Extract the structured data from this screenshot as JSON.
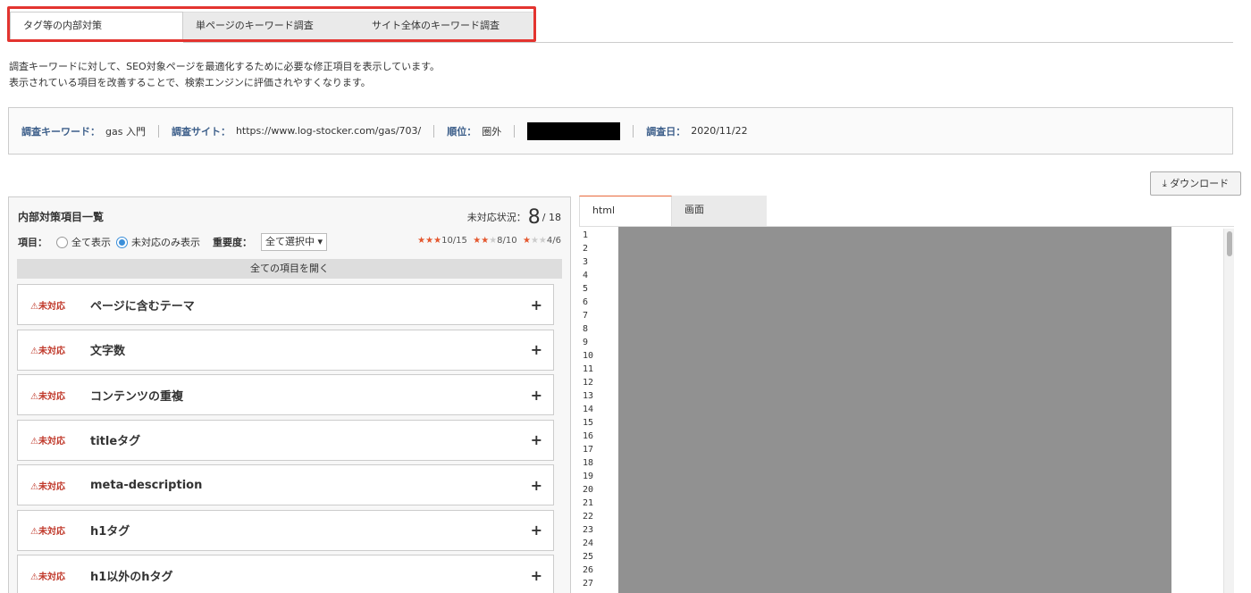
{
  "top_tabs": [
    {
      "label": "タグ等の内部対策"
    },
    {
      "label": "単ページのキーワード調査"
    },
    {
      "label": "サイト全体のキーワード調査"
    }
  ],
  "description": {
    "line1": "調査キーワードに対して、SEO対象ページを最適化するために必要な修正項目を表示しています。",
    "line2": "表示されている項目を改善することで、検索エンジンに評価されやすくなります。"
  },
  "info": {
    "keyword_label": "調査キーワード：",
    "keyword_value": "gas 入門",
    "site_label": "調査サイト：",
    "site_value": "https://www.log-stocker.com/gas/703/",
    "rank_label": "順位：",
    "rank_value": "圏外",
    "date_label": "調査日：",
    "date_value": "2020/11/22"
  },
  "download_label": "ダウンロード",
  "panel": {
    "title": "内部対策項目一覧",
    "status_label": "未対応状況：",
    "status_count": "8",
    "status_total": "/ 18",
    "filter_label": "項目：",
    "radio_all": "全て表示",
    "radio_unresolved": "未対応のみ表示",
    "importance_label": "重要度：",
    "importance_value": "全て選択中",
    "stars3": "10/15",
    "stars2": "8/10",
    "stars1": "4/6",
    "open_all": "全ての項目を開く",
    "items": [
      {
        "status": "未対応",
        "name": "ページに含むテーマ"
      },
      {
        "status": "未対応",
        "name": "文字数"
      },
      {
        "status": "未対応",
        "name": "コンテンツの重複"
      },
      {
        "status": "未対応",
        "name": "titleタグ"
      },
      {
        "status": "未対応",
        "name": "meta-description"
      },
      {
        "status": "未対応",
        "name": "h1タグ"
      },
      {
        "status": "未対応",
        "name": "h1以外のhタグ"
      }
    ]
  },
  "right_tabs": [
    {
      "label": "html"
    },
    {
      "label": "画面"
    }
  ],
  "line_numbers": "1\n2\n3\n4\n5\n6\n7\n8\n9\n10\n11\n12\n13\n14\n15\n16\n17\n18\n19\n20\n21\n22\n23\n24\n25\n26\n27",
  "colors": {
    "highlight": "#e3342f",
    "warning": "#c0392b",
    "accent": "#e8683b"
  }
}
